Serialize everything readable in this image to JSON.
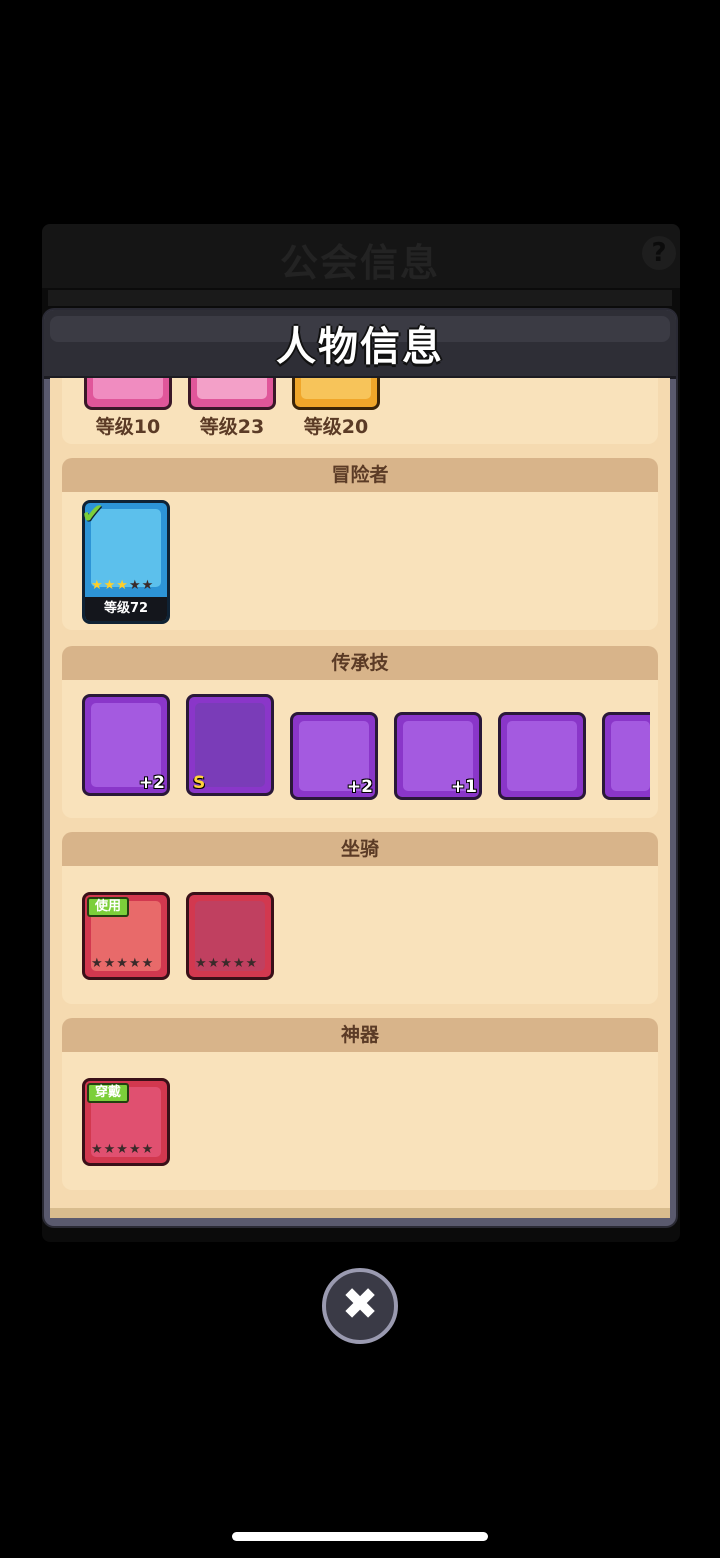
{
  "background_panel": {
    "title": "公会信息",
    "help_icon": "question-icon"
  },
  "dialog": {
    "title": "人物信息"
  },
  "top_levels": [
    "等级10",
    "等级23",
    "等级20"
  ],
  "sections": {
    "adventurer": {
      "title": "冒险者",
      "card": {
        "level": "等级72",
        "stars_on": 3,
        "stars_total": 5,
        "selected": true
      }
    },
    "legacy_skills": {
      "title": "传承技",
      "items": [
        {
          "badge": "+2",
          "grade": ""
        },
        {
          "badge": "",
          "grade": "S"
        },
        {
          "badge": "+2",
          "grade": ""
        },
        {
          "badge": "+1",
          "grade": ""
        },
        {
          "badge": "",
          "grade": ""
        },
        {
          "badge": "",
          "grade": ""
        }
      ]
    },
    "mounts": {
      "title": "坐骑",
      "items": [
        {
          "tag": "使用"
        },
        {
          "tag": ""
        }
      ]
    },
    "artifacts": {
      "title": "神器",
      "items": [
        {
          "tag": "穿戴"
        }
      ]
    }
  },
  "close_icon": "close-icon"
}
